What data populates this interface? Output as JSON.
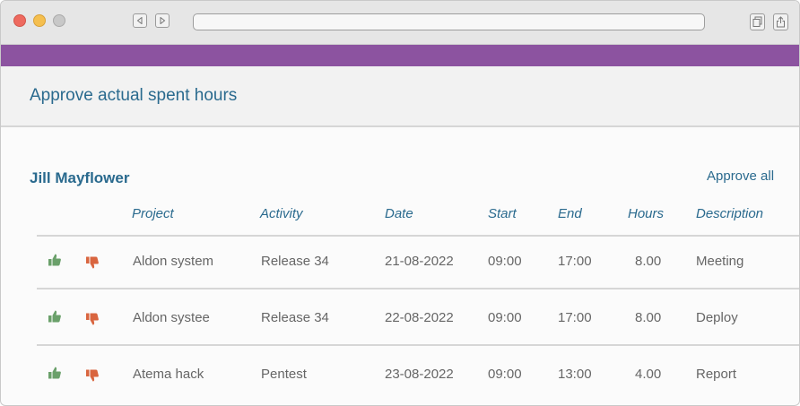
{
  "page": {
    "title": "Approve actual spent hours"
  },
  "user": {
    "name": "Jill Mayflower"
  },
  "actions": {
    "approve_all": "Approve all"
  },
  "table": {
    "headers": [
      "Project",
      "Activity",
      "Date",
      "Start",
      "End",
      "Hours",
      "Description"
    ],
    "rows": [
      [
        "Aldon system",
        "Release 34",
        "21-08-2022",
        "09:00",
        "17:00",
        "8.00",
        "Meeting"
      ],
      [
        "Aldon systee",
        "Release 34",
        "22-08-2022",
        "09:00",
        "17:00",
        "8.00",
        "Deploy"
      ],
      [
        "Atema hack",
        "Pentest",
        "23-08-2022",
        "09:00",
        "13:00",
        "4.00",
        "Report"
      ]
    ]
  },
  "colors": {
    "accent": "#2a6a8e",
    "brand_bar": "#8c53a0",
    "approve": "#6aa06a",
    "reject": "#d9653f"
  },
  "icons": {
    "approve": "thumbs-up-icon",
    "reject": "thumbs-down-icon"
  }
}
